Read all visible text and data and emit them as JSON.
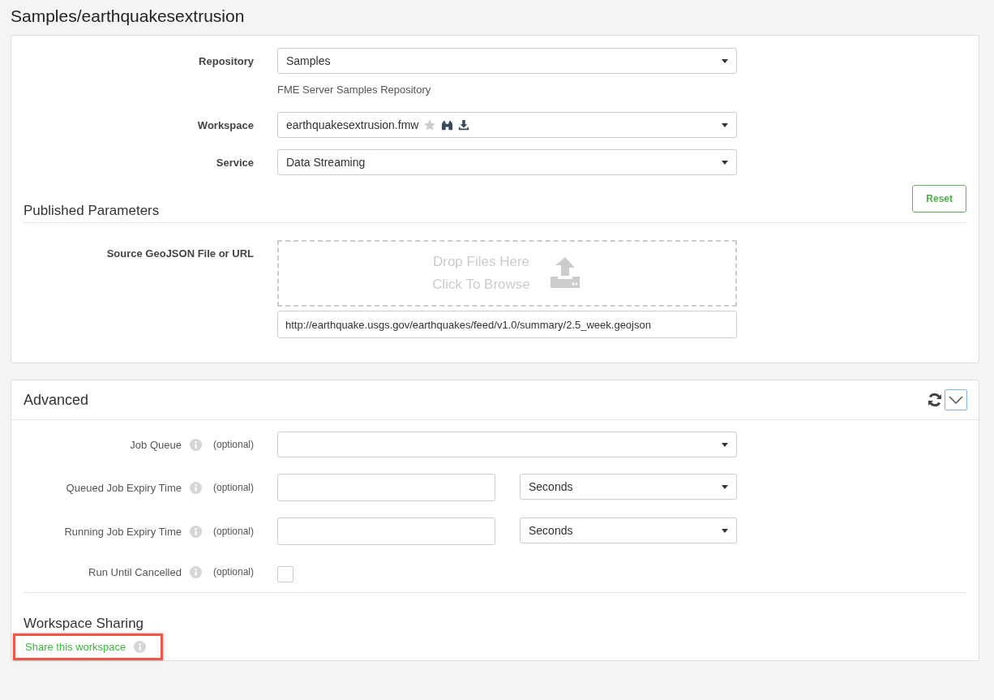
{
  "page_title": "Samples/earthquakesextrusion",
  "main_fields": [
    {
      "kind": "select",
      "label": "Repository",
      "value": "Samples",
      "help": "FME Server Samples Repository"
    },
    {
      "kind": "workspace",
      "label": "Workspace",
      "value": "earthquakesextrusion.fmw"
    },
    {
      "kind": "select",
      "label": "Service",
      "value": "Data Streaming"
    }
  ],
  "reset_button": "Reset",
  "published_parameters": {
    "title": "Published Parameters",
    "label": "Source GeoJSON File or URL",
    "drop_text": "Drop Files Here",
    "browse_text": "Click To Browse",
    "value": "http://earthquake.usgs.gov/earthquakes/feed/v1.0/summary/2.5_week.geojson"
  },
  "advanced": {
    "title": "Advanced",
    "expanded": true,
    "rows": [
      {
        "kind": "select",
        "label": "Job Queue",
        "note": "(optional)"
      },
      {
        "kind": "duration",
        "label": "Queued Job Expiry Time",
        "note": "(optional)",
        "unit": "Seconds"
      },
      {
        "kind": "duration",
        "label": "Running Job Expiry Time",
        "note": "(optional)",
        "unit": "Seconds"
      },
      {
        "kind": "checkbox",
        "label": "Run Until Cancelled",
        "note": "(optional)",
        "checked": false
      }
    ]
  },
  "sharing": {
    "title": "Workspace Sharing",
    "link": "Share this workspace",
    "highlighted": true
  }
}
